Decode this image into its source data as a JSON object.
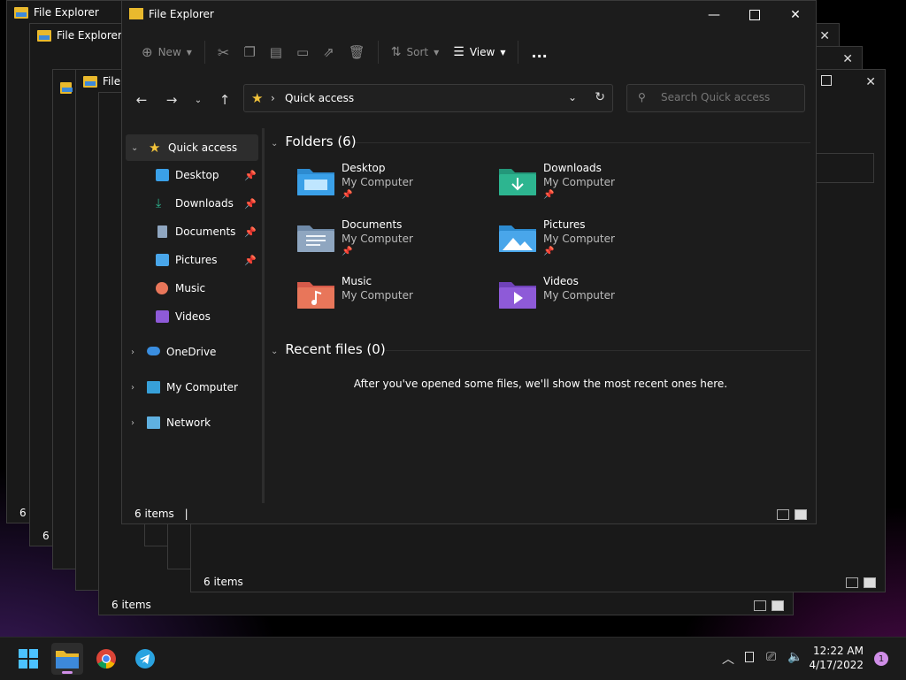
{
  "app_title": "File Explorer",
  "background_windows": {
    "title": "File Explorer",
    "status_text": "6 items"
  },
  "toolbar": {
    "new_label": "New",
    "sort_label": "Sort",
    "view_label": "View",
    "more_label": "..."
  },
  "address": {
    "location": "Quick access",
    "search_placeholder": "Search Quick access"
  },
  "sidebar": {
    "items": [
      {
        "label": "Quick access",
        "icon": "star-icon",
        "pinned": false
      },
      {
        "label": "Desktop",
        "icon": "desktop-icon",
        "pinned": true
      },
      {
        "label": "Downloads",
        "icon": "download-icon",
        "pinned": true
      },
      {
        "label": "Documents",
        "icon": "document-icon",
        "pinned": true
      },
      {
        "label": "Pictures",
        "icon": "pictures-icon",
        "pinned": true
      },
      {
        "label": "Music",
        "icon": "music-icon",
        "pinned": false
      },
      {
        "label": "Videos",
        "icon": "videos-icon",
        "pinned": false
      },
      {
        "label": "OneDrive",
        "icon": "cloud-icon",
        "pinned": false
      },
      {
        "label": "My Computer",
        "icon": "computer-icon",
        "pinned": false
      },
      {
        "label": "Network",
        "icon": "network-icon",
        "pinned": false
      }
    ]
  },
  "folders_section": {
    "title": "Folders (6)",
    "folders": [
      {
        "name": "Desktop",
        "location": "My Computer",
        "pinned": true,
        "color": "#3aa0e8"
      },
      {
        "name": "Downloads",
        "location": "My Computer",
        "pinned": true,
        "color": "#2db590"
      },
      {
        "name": "Documents",
        "location": "My Computer",
        "pinned": true,
        "color": "#8fa6c0"
      },
      {
        "name": "Pictures",
        "location": "My Computer",
        "pinned": true,
        "color": "#49a6ea"
      },
      {
        "name": "Music",
        "location": "My Computer",
        "pinned": false,
        "color": "#e8765a"
      },
      {
        "name": "Videos",
        "location": "My Computer",
        "pinned": false,
        "color": "#8e5ad8"
      }
    ]
  },
  "recent_section": {
    "title": "Recent files (0)",
    "empty_message": "After you've opened some files, we'll show the most recent ones here."
  },
  "status": {
    "items_text": "6 items"
  },
  "taskbar": {
    "time": "12:22 AM",
    "date": "4/17/2022",
    "notification_count": "1"
  },
  "colors": {
    "accent": "#f2c33a",
    "window_bg": "#1c1c1c"
  }
}
